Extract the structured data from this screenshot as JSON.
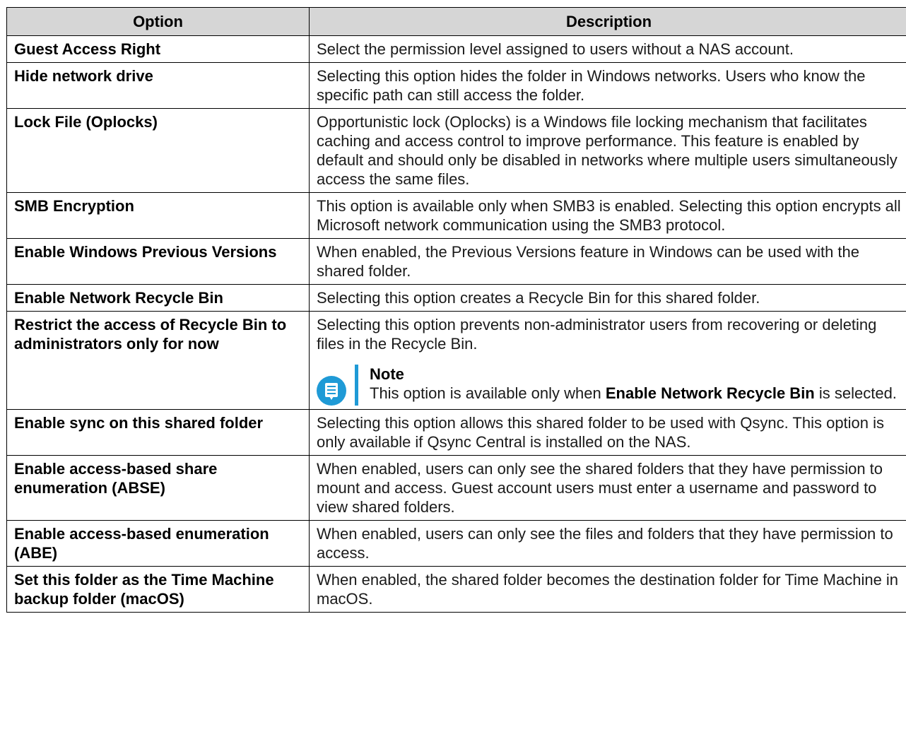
{
  "table": {
    "headers": [
      "Option",
      "Description"
    ],
    "rows": [
      {
        "option": "Guest Access Right",
        "description": "Select the permission level assigned to users without a NAS account."
      },
      {
        "option": "Hide network drive",
        "description": "Selecting this option hides the folder in Windows networks. Users who know the specific path can still access the folder."
      },
      {
        "option": "Lock File (Oplocks)",
        "description": "Opportunistic lock (Oplocks) is a Windows file locking mechanism that facilitates caching and access control to improve performance. This feature is enabled by default and should only be disabled in networks where multiple users simultaneously access the same files."
      },
      {
        "option": "SMB Encryption",
        "description": "This option is available only when SMB3 is enabled. Selecting this option encrypts all Microsoft network communication using the SMB3 protocol."
      },
      {
        "option": "Enable Windows Previous Versions",
        "description": "When enabled, the Previous Versions feature in Windows can be used with the shared folder."
      },
      {
        "option": "Enable Network Recycle Bin",
        "description": "Selecting this option creates a Recycle Bin for this shared folder."
      },
      {
        "option": "Restrict the access of Recycle Bin to administrators only for now",
        "description": "Selecting this option prevents non-administrator users from recovering or deleting files in the Recycle Bin.",
        "note": {
          "title": "Note",
          "text_before": "This option is available only when ",
          "text_bold": "Enable Network Recycle Bin",
          "text_after": " is selected.",
          "icon": "note-icon"
        }
      },
      {
        "option": "Enable sync on this shared folder",
        "description": "Selecting this option allows this shared folder to be used with Qsync. This option is only available if Qsync Central is installed on the NAS."
      },
      {
        "option": "Enable access-based share enumeration (ABSE)",
        "description": "When enabled, users can only see the shared folders that they have permission to mount and access. Guest account users must enter a username and password to view shared folders."
      },
      {
        "option": "Enable access-based enumeration (ABE)",
        "description": "When enabled, users can only see the files and folders that they have permission to access."
      },
      {
        "option": "Set this folder as the Time Machine backup folder (macOS)",
        "description": "When enabled, the shared folder becomes the destination folder for Time Machine in macOS."
      }
    ]
  },
  "colors": {
    "header_bg": "#d6d6d6",
    "note_accent": "#1f9ad6",
    "border": "#000000"
  }
}
